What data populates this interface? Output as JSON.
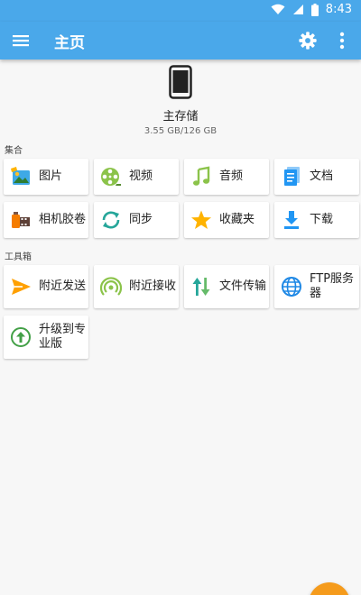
{
  "status_bar": {
    "time": "8:43",
    "icons": [
      "wifi-icon",
      "signal-icon",
      "battery-icon"
    ]
  },
  "app_bar": {
    "title": "主页",
    "icons": [
      "menu-icon",
      "gear-icon",
      "more-vert-icon"
    ]
  },
  "storage": {
    "name": "主存储",
    "size": "3.55 GB/126 GB",
    "icon": "phone-icon"
  },
  "sections": {
    "collections": {
      "label": "集合",
      "items": [
        {
          "label": "图片",
          "icon": "image-icon"
        },
        {
          "label": "视频",
          "icon": "film-reel-icon"
        },
        {
          "label": "音频",
          "icon": "music-note-icon"
        },
        {
          "label": "文档",
          "icon": "document-icon"
        },
        {
          "label": "相机胶卷",
          "icon": "film-roll-icon"
        },
        {
          "label": "同步",
          "icon": "sync-icon"
        },
        {
          "label": "收藏夹",
          "icon": "star-icon"
        },
        {
          "label": "下载",
          "icon": "download-icon"
        }
      ]
    },
    "toolbox": {
      "label": "工具箱",
      "items": [
        {
          "label": "附近发送",
          "icon": "send-icon"
        },
        {
          "label": "附近接收",
          "icon": "receive-icon"
        },
        {
          "label": "文件传输",
          "icon": "transfer-icon"
        },
        {
          "label": "FTP服务器",
          "icon": "globe-icon"
        },
        {
          "label": "升级到专业版",
          "icon": "upgrade-icon"
        }
      ]
    }
  },
  "colors": {
    "primary": "#4aa8ea",
    "fab": "#f59b1c",
    "background": "#f7f7f7"
  }
}
